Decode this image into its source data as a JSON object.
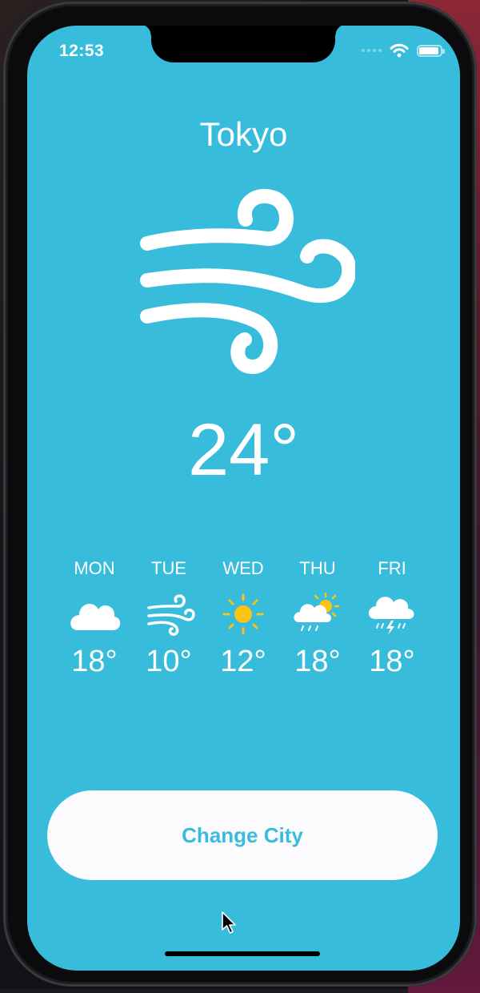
{
  "status_bar": {
    "time": "12:53"
  },
  "weather": {
    "city": "Tokyo",
    "temperature": "24°",
    "condition_icon": "wind-icon"
  },
  "forecast": [
    {
      "day": "MON",
      "temp": "18°",
      "icon": "cloud-icon"
    },
    {
      "day": "TUE",
      "temp": "10°",
      "icon": "wind-icon"
    },
    {
      "day": "WED",
      "temp": "12°",
      "icon": "sun-icon"
    },
    {
      "day": "THU",
      "temp": "18°",
      "icon": "sun-cloud-rain-icon"
    },
    {
      "day": "FRI",
      "temp": "18°",
      "icon": "thunderstorm-icon"
    }
  ],
  "actions": {
    "change_city_label": "Change City"
  },
  "colors": {
    "background": "#38bcdc",
    "button_bg": "#fbfbfe",
    "button_text": "#38bcdc",
    "sun": "#fcc419"
  }
}
